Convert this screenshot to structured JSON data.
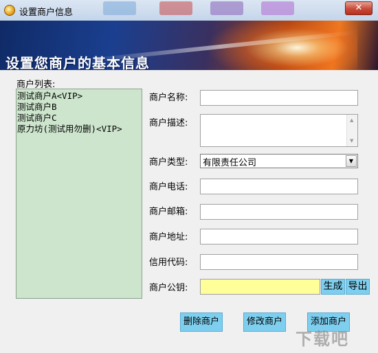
{
  "window": {
    "title": "设置商户信息",
    "close_label": "✕"
  },
  "banner": {
    "title": "设置您商户的基本信息"
  },
  "merchant_list": {
    "label": "商户列表:",
    "items": [
      "测试商户A<VIP>",
      "测试商户B",
      "测试商户C",
      "原力坊(测试用勿删)<VIP>"
    ]
  },
  "form": {
    "name_label": "商户名称:",
    "name_value": "",
    "desc_label": "商户描述:",
    "desc_value": "",
    "type_label": "商户类型:",
    "type_selected": "有限责任公司",
    "phone_label": "商户电话:",
    "phone_value": "",
    "email_label": "商户邮箱:",
    "email_value": "",
    "address_label": "商户地址:",
    "address_value": "",
    "credit_label": "信用代码:",
    "credit_value": "",
    "key_label": "商户公钥:",
    "key_value": "",
    "generate_label": "生成",
    "export_label": "导出"
  },
  "actions": {
    "delete_label": "删除商户",
    "modify_label": "修改商户",
    "add_label": "添加商户"
  },
  "watermark": "下载吧",
  "colors": {
    "list_bg": "#cde5cd",
    "key_bg": "#ffff99",
    "button_bg": "#7ecfef"
  }
}
